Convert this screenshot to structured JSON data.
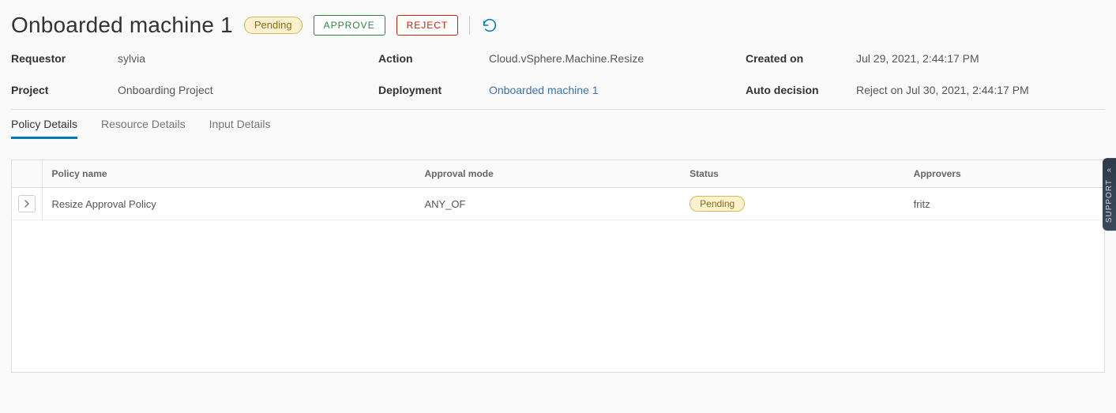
{
  "header": {
    "title": "Onboarded machine 1",
    "status_badge": "Pending",
    "approve_label": "APPROVE",
    "reject_label": "REJECT"
  },
  "props": {
    "requestor_label": "Requestor",
    "requestor_value": "sylvia",
    "action_label": "Action",
    "action_value": "Cloud.vSphere.Machine.Resize",
    "createdon_label": "Created on",
    "createdon_value": "Jul 29, 2021, 2:44:17 PM",
    "project_label": "Project",
    "project_value": "Onboarding Project",
    "deployment_label": "Deployment",
    "deployment_value": "Onboarded machine 1",
    "autodecision_label": "Auto decision",
    "autodecision_value": "Reject on Jul 30, 2021, 2:44:17 PM"
  },
  "tabs": {
    "policy": "Policy Details",
    "resource": "Resource Details",
    "input": "Input Details"
  },
  "table": {
    "col_policy_name": "Policy name",
    "col_approval_mode": "Approval mode",
    "col_status": "Status",
    "col_approvers": "Approvers",
    "rows": [
      {
        "policy_name": "Resize Approval Policy",
        "approval_mode": "ANY_OF",
        "status": "Pending",
        "approvers": "fritz"
      }
    ]
  },
  "support_label": "SUPPORT"
}
